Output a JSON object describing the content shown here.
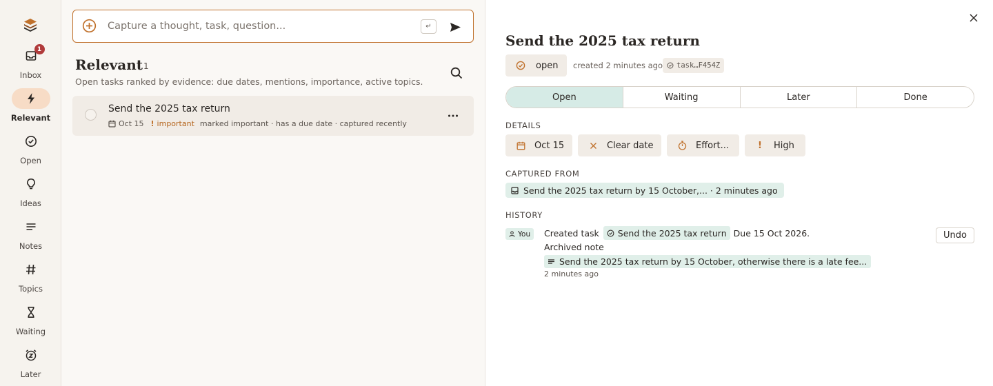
{
  "colors": {
    "accent": "#c0712c",
    "active_nav": "#f7dcc6",
    "open_segment": "#d6ebe6",
    "chip_green": "#e0efe9",
    "badge": "#b03a3a"
  },
  "sidebar": {
    "items": [
      {
        "label": "Inbox",
        "icon": "inbox-icon",
        "badge": "1"
      },
      {
        "label": "Relevant",
        "icon": "lightning-icon",
        "active": true
      },
      {
        "label": "Open",
        "icon": "check-circle-icon"
      },
      {
        "label": "Ideas",
        "icon": "lightbulb-icon"
      },
      {
        "label": "Notes",
        "icon": "lines-icon"
      },
      {
        "label": "Topics",
        "icon": "hash-icon"
      },
      {
        "label": "Waiting",
        "icon": "hourglass-icon"
      },
      {
        "label": "Later",
        "icon": "alarm-clock-icon"
      }
    ]
  },
  "capture": {
    "placeholder": "Capture a thought, task, question...",
    "kbd": "↵"
  },
  "list": {
    "title": "Relevant",
    "count": "1",
    "subtitle": "Open tasks ranked by evidence: due dates, mentions, importance, active topics.",
    "tasks": [
      {
        "title": "Send the 2025 tax return",
        "due": "Oct 15",
        "importance": "important",
        "reasons": "marked important · has a due date · captured recently"
      }
    ]
  },
  "detail": {
    "title": "Send the 2025 tax return",
    "status": "open",
    "created": "created 2 minutes ago",
    "task_id": "task…F454Z",
    "segments": [
      "Open",
      "Waiting",
      "Later",
      "Done"
    ],
    "active_segment": "Open",
    "details_label": "DETAILS",
    "details": {
      "date": "Oct 15",
      "clear": "Clear date",
      "effort": "Effort...",
      "priority": "High"
    },
    "captured_label": "CAPTURED FROM",
    "captured_text": "Send the 2025 tax return by 15 October,... · 2 minutes ago",
    "history_label": "HISTORY",
    "history": {
      "actor": "You",
      "action1": "Created task",
      "task_ref": "Send the 2025 tax return",
      "due_text": "Due 15 Oct 2026.",
      "action2": "Archived note",
      "note_ref": "Send the 2025 tax return by 15 October, otherwise there is a late fee...",
      "time": "2 minutes ago",
      "undo": "Undo"
    }
  }
}
